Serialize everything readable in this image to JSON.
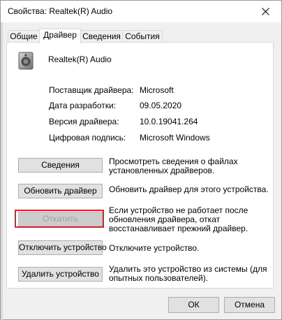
{
  "window": {
    "title": "Свойства: Realtek(R) Audio",
    "close_icon": "close-icon"
  },
  "tabs": [
    {
      "label": "Общие",
      "active": false
    },
    {
      "label": "Драйвер",
      "active": true
    },
    {
      "label": "Сведения",
      "active": false
    },
    {
      "label": "События",
      "active": false
    }
  ],
  "device": {
    "icon": "speaker-icon",
    "name": "Realtek(R) Audio"
  },
  "properties": [
    {
      "label": "Поставщик драйвера:",
      "value": "Microsoft"
    },
    {
      "label": "Дата разработки:",
      "value": "09.05.2020"
    },
    {
      "label": "Версия драйвера:",
      "value": "10.0.19041.264"
    },
    {
      "label": "Цифровая подпись:",
      "value": "Microsoft Windows"
    }
  ],
  "actions": [
    {
      "label": "Сведения",
      "description": "Просмотреть сведения о файлах установленных драйверов.",
      "enabled": true
    },
    {
      "label": "Обновить драйвер",
      "description": "Обновить драйвер для этого устройства.",
      "enabled": true
    },
    {
      "label": "Откатить",
      "description": "Если устройство не работает после обновления драйвера, откат восстанавливает прежний драйвер.",
      "enabled": false,
      "highlighted": true
    },
    {
      "label": "Отключить устройство",
      "description": "Отключите устройство.",
      "enabled": true
    },
    {
      "label": "Удалить устройство",
      "description": "Удалить это устройство из системы (для опытных пользователей).",
      "enabled": true
    }
  ],
  "footer": {
    "ok_label": "ОК",
    "cancel_label": "Отмена"
  },
  "colors": {
    "highlight_border": "#e01e2b",
    "window_bg": "#f0f0f0",
    "panel_bg": "#ffffff"
  }
}
